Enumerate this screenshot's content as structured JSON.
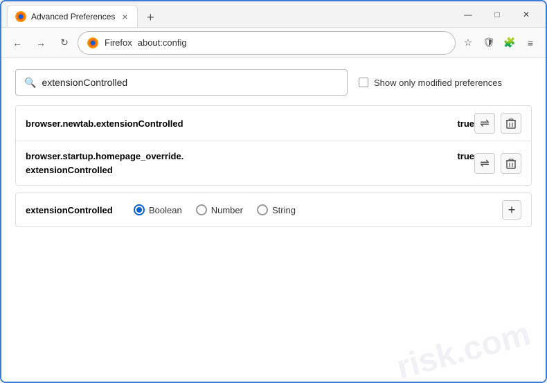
{
  "window": {
    "title": "Advanced Preferences",
    "tab_close": "×",
    "new_tab": "+",
    "win_minimize": "—",
    "win_maximize": "□",
    "win_close": "✕"
  },
  "nav": {
    "back_label": "←",
    "forward_label": "→",
    "refresh_label": "↻",
    "browser_name": "Firefox",
    "url": "about:config",
    "bookmark_icon": "☆",
    "shield_icon": "🛡",
    "extension_icon": "🧩",
    "menu_icon": "≡"
  },
  "search": {
    "placeholder": "extensionControlled",
    "show_modified_label": "Show only modified preferences"
  },
  "preferences": {
    "rows": [
      {
        "name": "browser.newtab.extensionControlled",
        "value": "true"
      },
      {
        "name": "browser.startup.homepage_override.\nextensionControlled",
        "name_line1": "browser.startup.homepage_override.",
        "name_line2": "extensionControlled",
        "value": "true",
        "multiline": true
      }
    ]
  },
  "add_preference": {
    "name": "extensionControlled",
    "types": [
      {
        "id": "boolean",
        "label": "Boolean",
        "selected": true
      },
      {
        "id": "number",
        "label": "Number",
        "selected": false
      },
      {
        "id": "string",
        "label": "String",
        "selected": false
      }
    ],
    "add_btn_label": "+"
  },
  "actions": {
    "toggle_label": "⇌",
    "delete_label": "🗑"
  },
  "watermark": {
    "line1": "risk.com"
  }
}
